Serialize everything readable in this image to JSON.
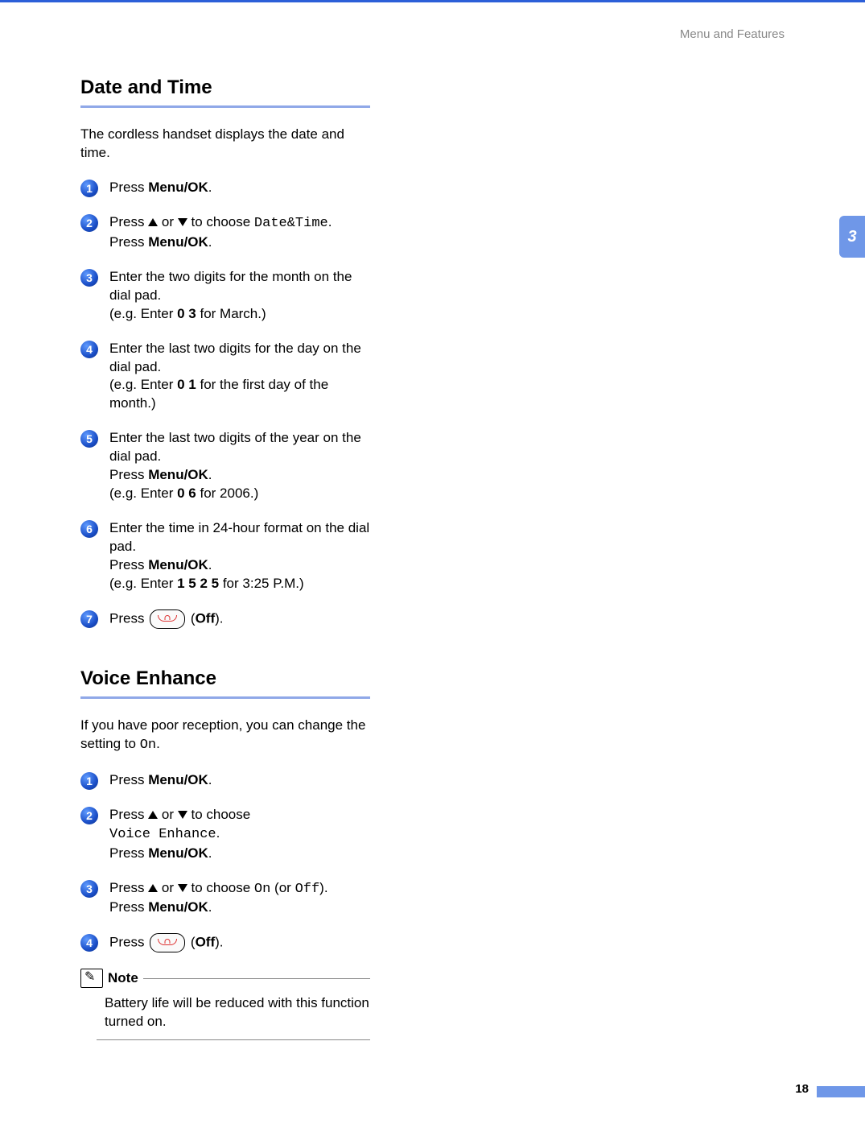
{
  "header": "Menu and Features",
  "sideTab": "3",
  "pageNumber": "18",
  "sections": [
    {
      "title": "Date and Time",
      "intro": "The cordless handset displays the date and time.",
      "steps": [
        {
          "n": "1",
          "parts": [
            {
              "t": "Press "
            },
            {
              "t": "Menu/OK",
              "b": true
            },
            {
              "t": "."
            }
          ]
        },
        {
          "n": "2",
          "parts": [
            {
              "t": "Press "
            },
            {
              "up": true
            },
            {
              "t": " or "
            },
            {
              "down": true
            },
            {
              "t": " to choose "
            },
            {
              "t": "Date&Time",
              "m": true
            },
            {
              "t": "."
            },
            {
              "br": true
            },
            {
              "t": "Press "
            },
            {
              "t": "Menu/OK",
              "b": true
            },
            {
              "t": "."
            }
          ]
        },
        {
          "n": "3",
          "parts": [
            {
              "t": "Enter the two digits for the month on the dial pad."
            },
            {
              "br": true
            },
            {
              "t": "(e.g. Enter "
            },
            {
              "t": "0 3",
              "b": true
            },
            {
              "t": " for March.)"
            }
          ]
        },
        {
          "n": "4",
          "parts": [
            {
              "t": "Enter the last two digits for the day on the dial pad."
            },
            {
              "br": true
            },
            {
              "t": "(e.g. Enter "
            },
            {
              "t": "0 1",
              "b": true
            },
            {
              "t": " for the first day of the month.)"
            }
          ]
        },
        {
          "n": "5",
          "parts": [
            {
              "t": "Enter the last two digits of the year on the dial pad."
            },
            {
              "br": true
            },
            {
              "t": "Press "
            },
            {
              "t": "Menu/OK",
              "b": true
            },
            {
              "t": "."
            },
            {
              "br": true
            },
            {
              "t": "(e.g. Enter "
            },
            {
              "t": "0 6",
              "b": true
            },
            {
              "t": " for 2006.)"
            }
          ]
        },
        {
          "n": "6",
          "parts": [
            {
              "t": "Enter the time in 24-hour format on the dial pad."
            },
            {
              "br": true
            },
            {
              "t": "Press "
            },
            {
              "t": "Menu/OK",
              "b": true
            },
            {
              "t": "."
            },
            {
              "br": true
            },
            {
              "t": "(e.g. Enter "
            },
            {
              "t": "1 5 2 5",
              "b": true
            },
            {
              "t": " for 3:25 P.M.)"
            }
          ]
        },
        {
          "n": "7",
          "parts": [
            {
              "t": "Press "
            },
            {
              "off": true
            },
            {
              "t": " ("
            },
            {
              "t": "Off",
              "b": true
            },
            {
              "t": ")."
            }
          ]
        }
      ]
    },
    {
      "title": "Voice Enhance",
      "introParts": [
        {
          "t": "If you have poor reception, you can change the setting to "
        },
        {
          "t": "On",
          "m": true
        },
        {
          "t": "."
        }
      ],
      "steps": [
        {
          "n": "1",
          "parts": [
            {
              "t": "Press "
            },
            {
              "t": "Menu/OK",
              "b": true
            },
            {
              "t": "."
            }
          ]
        },
        {
          "n": "2",
          "parts": [
            {
              "t": "Press "
            },
            {
              "up": true
            },
            {
              "t": " or "
            },
            {
              "down": true
            },
            {
              "t": " to choose "
            },
            {
              "br": true
            },
            {
              "t": "Voice Enhance",
              "m": true
            },
            {
              "t": "."
            },
            {
              "br": true
            },
            {
              "t": "Press "
            },
            {
              "t": "Menu/OK",
              "b": true
            },
            {
              "t": "."
            }
          ]
        },
        {
          "n": "3",
          "parts": [
            {
              "t": "Press "
            },
            {
              "up": true
            },
            {
              "t": " or "
            },
            {
              "down": true
            },
            {
              "t": " to choose "
            },
            {
              "t": "On",
              "m": true
            },
            {
              "t": " (or "
            },
            {
              "t": "Off",
              "m": true
            },
            {
              "t": ")."
            },
            {
              "br": true
            },
            {
              "t": "Press "
            },
            {
              "t": "Menu/OK",
              "b": true
            },
            {
              "t": "."
            }
          ]
        },
        {
          "n": "4",
          "parts": [
            {
              "t": "Press "
            },
            {
              "off": true
            },
            {
              "t": " ("
            },
            {
              "t": "Off",
              "b": true
            },
            {
              "t": ")."
            }
          ]
        }
      ],
      "note": {
        "title": "Note",
        "text": "Battery life will be reduced with this function turned on."
      }
    }
  ]
}
